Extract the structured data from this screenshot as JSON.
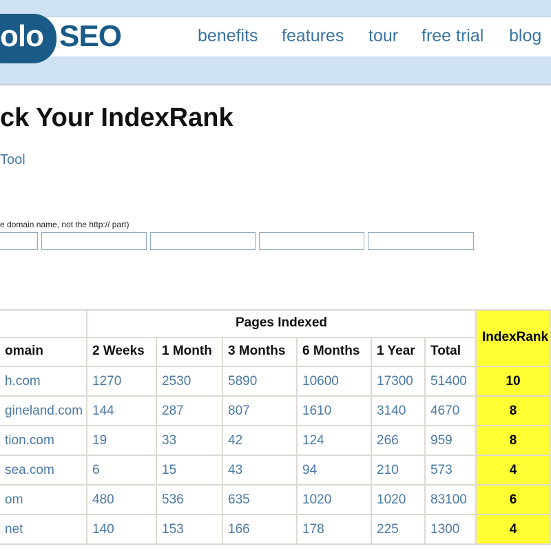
{
  "brand": {
    "logo_left": "olo",
    "logo_right": "SEO"
  },
  "nav": [
    "benefits",
    "features",
    "tour",
    "free trial",
    "blog"
  ],
  "page": {
    "title": "ck Your IndexRank",
    "tool_link": "Tool",
    "hint": "e domain name, not the http:// part)"
  },
  "inputs": [
    "",
    "",
    "",
    "",
    ""
  ],
  "table": {
    "group_header": "Pages Indexed",
    "columns": [
      "omain",
      "2 Weeks",
      "1 Month",
      "3 Months",
      "6 Months",
      "1 Year",
      "Total"
    ],
    "indexrank_header": "IndexRank",
    "rows": [
      {
        "domain": "h.com",
        "values": [
          "1270",
          "2530",
          "5890",
          "10600",
          "17300",
          "51400"
        ],
        "indexrank": "10"
      },
      {
        "domain": "gineland.com",
        "values": [
          "144",
          "287",
          "807",
          "1610",
          "3140",
          "4670"
        ],
        "indexrank": "8"
      },
      {
        "domain": "tion.com",
        "values": [
          "19",
          "33",
          "42",
          "124",
          "266",
          "959"
        ],
        "indexrank": "8"
      },
      {
        "domain": "sea.com",
        "values": [
          "6",
          "15",
          "43",
          "94",
          "210",
          "573"
        ],
        "indexrank": "4"
      },
      {
        "domain": "om",
        "values": [
          "480",
          "536",
          "635",
          "1020",
          "1020",
          "83100"
        ],
        "indexrank": "6"
      },
      {
        "domain": "net",
        "values": [
          "140",
          "153",
          "166",
          "178",
          "225",
          "1300"
        ],
        "indexrank": "4"
      }
    ]
  },
  "colors": {
    "brand_blue": "#1a5a86",
    "link_blue": "#3a74a3",
    "highlight": "#ffff33",
    "band": "#cfe2f3"
  }
}
